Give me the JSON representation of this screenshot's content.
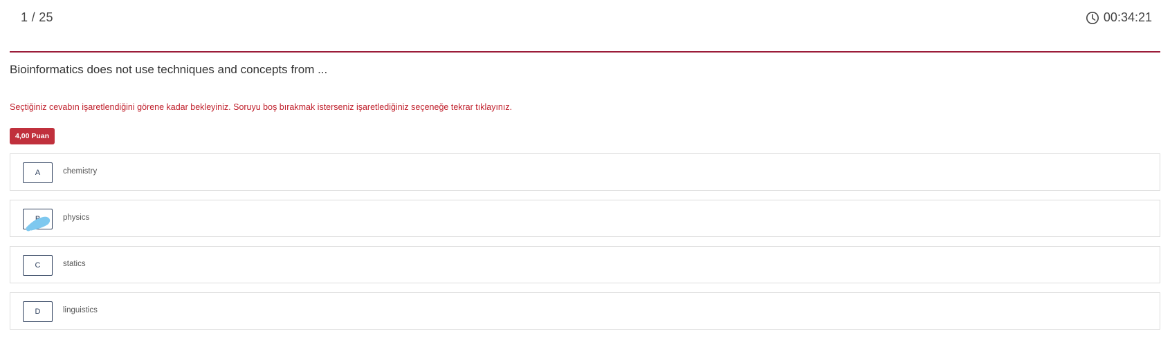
{
  "header": {
    "counter": "1 / 25",
    "timer": "00:34:21",
    "timer_icon": "clock-icon"
  },
  "question": {
    "text": "Bioinformatics does not use techniques and concepts from ...",
    "warning": "Seçtiğiniz cevabın işaretlendiğini görene kadar bekleyiniz. Soruyu boş bırakmak isterseniz işaretlediğiniz seçeneğe tekrar tıklayınız.",
    "points": "4,00 Puan"
  },
  "options": [
    {
      "letter": "A",
      "text": "chemistry"
    },
    {
      "letter": "B",
      "text": "physics"
    },
    {
      "letter": "C",
      "text": "statics"
    },
    {
      "letter": "D",
      "text": "linguistics"
    }
  ],
  "colors": {
    "accent": "#9b1c39",
    "warning": "#c0202c",
    "badge": "#c0303c",
    "option_border": "#2c3e5c",
    "scribble": "#7ec8ef"
  }
}
